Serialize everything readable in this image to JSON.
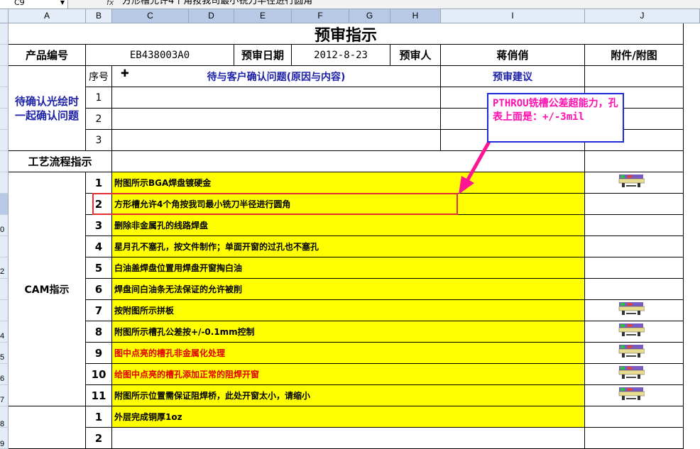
{
  "formula_bar": {
    "cell_ref": "C9",
    "fx": "fx",
    "formula": "方形槽允许4个角按我司最小铣刀半径进行圆角"
  },
  "columns": [
    "A",
    "B",
    "C",
    "D",
    "E",
    "F",
    "G",
    "H",
    "I",
    "J"
  ],
  "row_numbers": [
    "0",
    "",
    "2",
    "",
    "4",
    "5",
    "6",
    "7",
    "8",
    "9"
  ],
  "sheet": {
    "title": "预审指示",
    "product_no_label": "产品编号",
    "product_no": "EB438003A0",
    "review_date_label": "预审日期",
    "review_date": "2012-8-23",
    "reviewer_label": "预审人",
    "reviewer": "蒋俏俏",
    "attachment_label": "附件/附图",
    "confirm_label_line1": "待确认光绘时",
    "confirm_label_line2": "一起确认问题",
    "seq_label": "序号",
    "issue_header": "待与客户确认问题(原因与内容)",
    "suggest_header": "预审建议",
    "confirm_rows": [
      "1",
      "2",
      "3"
    ],
    "process_label": "工艺流程指示",
    "cam_label": "CAM指示",
    "cam_items": [
      {
        "no": "1",
        "text": "附图所示BGA焊盘镀硬金",
        "red": false,
        "attach": true
      },
      {
        "no": "2",
        "text": "方形槽允许4个角按我司最小铣刀半径进行圆角",
        "red": false,
        "attach": false
      },
      {
        "no": "3",
        "text": "删除非金属孔的线路焊盘",
        "red": false,
        "attach": false
      },
      {
        "no": "4",
        "text": "星月孔不塞孔，按文件制作；单面开窗的过孔也不塞孔",
        "red": false,
        "attach": false
      },
      {
        "no": "5",
        "text": "白油盖焊盘位置用焊盘开窗掏白油",
        "red": false,
        "attach": false
      },
      {
        "no": "6",
        "text": "焊盘间白油条无法保证的允许被削",
        "red": false,
        "attach": false
      },
      {
        "no": "7",
        "text": "按附图所示拼板",
        "red": false,
        "attach": true
      },
      {
        "no": "8",
        "text": "附图所示槽孔公差按+/-0.1mm控制",
        "red": false,
        "attach": true
      },
      {
        "no": "9",
        "text": "图中点亮的槽孔非金属化处理",
        "red": true,
        "attach": true
      },
      {
        "no": "10",
        "text": "给图中点亮的槽孔添加正常的阻焊开窗",
        "red": true,
        "attach": true
      },
      {
        "no": "11",
        "text": "附图所示位置需保证阻焊桥，此处开窗太小，请缩小",
        "red": false,
        "attach": true
      }
    ],
    "next_items": [
      {
        "no": "1",
        "text": "外层完成铜厚1oz"
      },
      {
        "no": "2",
        "text": ""
      }
    ]
  },
  "callout": {
    "text": "PTHROU铣槽公差超能力，孔表上面是：+/-3mil"
  },
  "colors": {
    "highlight": "#ffff00",
    "label_blue": "#1d22a8",
    "callout_text": "#ff0fb0",
    "callout_border": "#1c2bd6",
    "arrow": "#ff1493",
    "red_box": "#e03030"
  }
}
